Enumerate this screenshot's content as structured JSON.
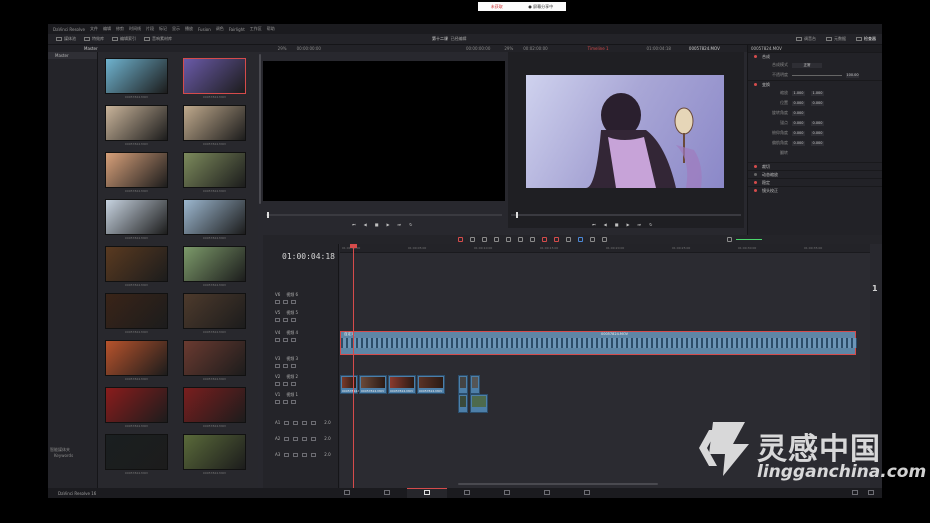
{
  "app": {
    "title": "DaVinci Resolve",
    "menu": [
      "DaVinci Resolve",
      "文件",
      "编辑",
      "修剪",
      "时间线",
      "片段",
      "标记",
      "显示",
      "播放",
      "Fusion",
      "调色",
      "Fairlight",
      "工作区",
      "帮助"
    ],
    "project_name": "第十二课",
    "project_status": "已经编辑"
  },
  "notice": {
    "live_label": "未获取",
    "share_label": "● 屏幕分享中"
  },
  "toolbar": {
    "media_pool": "媒体池",
    "effects": "特效库",
    "edit_index": "编辑索引",
    "sound_library": "音响素材库",
    "mixer": "调音台",
    "metadata": "元数据",
    "inspector": "检查器"
  },
  "subbar": {
    "bin_label": "Master",
    "zoom_left": "29%",
    "timecode_left": "00:00:00:00",
    "src_duration": "00:00:00:00",
    "zoom_right": "29%",
    "tc_right": "00:02:00:00",
    "timeline_name": "Timeline 1",
    "tc_current": "01:00:04:18",
    "clip_name": "00057824.MOV"
  },
  "bins": {
    "master": "Master",
    "smart_bins_title": "智能媒体夹",
    "smart_bins_item": "Keywords"
  },
  "media_pool": {
    "clips": [
      {
        "name": "00057824.MOV",
        "selected": false,
        "color": "#6fb3cf"
      },
      {
        "name": "00057824.MOV",
        "selected": true,
        "color": "#6a5aa8"
      },
      {
        "name": "00057824.MOV",
        "selected": false,
        "color": "#c9b49a"
      },
      {
        "name": "00057824.MOV",
        "selected": false,
        "color": "#bfa98c"
      },
      {
        "name": "00057824.MOV",
        "selected": false,
        "color": "#d7a07a"
      },
      {
        "name": "00057824.MOV",
        "selected": false,
        "color": "#7c8a5c"
      },
      {
        "name": "00057824.MOV",
        "selected": false,
        "color": "#c7d3e0"
      },
      {
        "name": "00057824.MOV",
        "selected": false,
        "color": "#9cb7cf"
      },
      {
        "name": "00057824.MOV",
        "selected": false,
        "color": "#5a3a20"
      },
      {
        "name": "00057824.MOV",
        "selected": false,
        "color": "#7c9a6a"
      },
      {
        "name": "00057824.MOV",
        "selected": false,
        "color": "#3a2418"
      },
      {
        "name": "00057824.MOV",
        "selected": false,
        "color": "#4d3a2c"
      },
      {
        "name": "00057824.MOV",
        "selected": false,
        "color": "#b8532c"
      },
      {
        "name": "00057824.MOV",
        "selected": false,
        "color": "#6a3a30"
      },
      {
        "name": "00057824.MOV",
        "selected": false,
        "color": "#8a1c1c"
      },
      {
        "name": "00057824.MOV",
        "selected": false,
        "color": "#7a1e1e"
      },
      {
        "name": "00057824.MOV",
        "selected": false,
        "color": "#1a1f20"
      },
      {
        "name": "00057824.MOV",
        "selected": false,
        "color": "#5a6a3a"
      }
    ]
  },
  "inspector": {
    "clip_title": "00057824.MOV",
    "sections": {
      "composite": "合成",
      "transform": "变换",
      "cropping": "裁切",
      "dynamic_zoom": "动态缩放",
      "stabilization": "稳定",
      "lens_correction": "镜头校正"
    },
    "composite_mode_label": "合成模式",
    "composite_mode_value": "正常",
    "opacity_label": "不透明度",
    "opacity_value": "100.00",
    "rows": [
      {
        "label": "缩放",
        "a": "1.000",
        "b": "1.000"
      },
      {
        "label": "位置",
        "a": "0.000",
        "b": "0.000"
      },
      {
        "label": "旋转角度",
        "a": "0.000",
        "b": ""
      },
      {
        "label": "锚点",
        "a": "0.000",
        "b": "0.000"
      },
      {
        "label": "俯仰角度",
        "a": "0.000",
        "b": "0.000"
      },
      {
        "label": "偏航角度",
        "a": "0.000",
        "b": "0.000"
      },
      {
        "label": "翻转",
        "a": "",
        "b": ""
      }
    ]
  },
  "timeline": {
    "timecode": "01:00:04:18",
    "ruler": [
      "01:00:00:00",
      "01:00:05:00",
      "01:00:10:00",
      "01:00:15:00",
      "01:00:20:00",
      "01:00:25:00",
      "01:00:30:00",
      "01:00:35:00"
    ],
    "tracks": [
      {
        "id": "V6",
        "name": "视频 6"
      },
      {
        "id": "V5",
        "name": "视频 5"
      },
      {
        "id": "V4",
        "name": "视频 4"
      },
      {
        "id": "V3",
        "name": "视频 3"
      },
      {
        "id": "V2",
        "name": "视频 2"
      },
      {
        "id": "V1",
        "name": "视频 1"
      }
    ],
    "audio_tracks": [
      {
        "id": "A1",
        "level": "2.0"
      },
      {
        "id": "A2",
        "level": "2.0"
      },
      {
        "id": "A3",
        "level": "2.0"
      }
    ],
    "big_clip_label": "自定义",
    "big_clip_name": "00057824.MOV",
    "v2_clips": [
      "00057824.MOV",
      "00057824.MOV",
      "00057824.MOV",
      "00057824.MOV"
    ],
    "side_number": "1"
  },
  "pagebar": {
    "product": "DaVinci Resolve 16"
  },
  "watermark": {
    "cn": "灵感中国",
    "url": "lingganchina.com"
  }
}
